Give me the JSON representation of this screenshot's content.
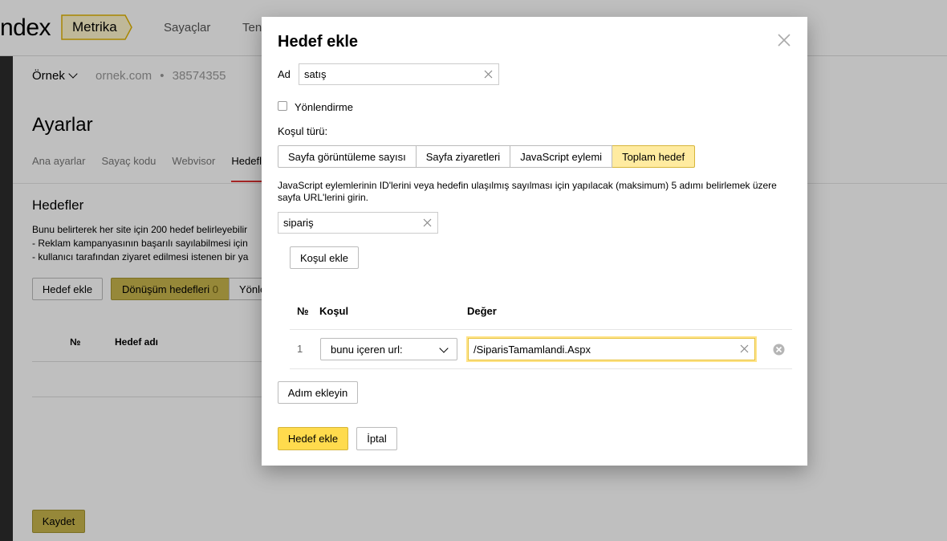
{
  "app": {
    "logo_text": "ndex",
    "product_tab": "Metrika",
    "nav": [
      "Sayaçlar",
      "Ten"
    ]
  },
  "site": {
    "name": "Örnek",
    "domain": "ornek.com",
    "separator": "•",
    "counter_id": "38574355"
  },
  "page": {
    "title": "Ayarlar",
    "tabs": [
      "Ana ayarlar",
      "Sayaç kodu",
      "Webvisor",
      "Hedefl"
    ],
    "active_tab_index": 3,
    "section_title": "Hedefler",
    "description": [
      "Bunu belirterek her site için 200 hedef belirleyebilir",
      "- Reklam kampanyasının başarılı sayılabilmesi için",
      "- kullanıcı tarafından ziyaret edilmesi istenen bir ya"
    ],
    "add_goal_button": "Hedef ekle",
    "filter_conversion": "Dönüşüm hedefleri",
    "filter_conversion_count": "0",
    "filter_other": "Yönle",
    "table_headers": [
      "№",
      "Hedef adı"
    ],
    "save_button": "Kaydet"
  },
  "modal": {
    "title": "Hedef ekle",
    "name_label": "Ad",
    "name_value": "satış",
    "redirect_label": "Yönlendirme",
    "redirect_checked": false,
    "condition_type_label": "Koşul türü:",
    "condition_types": [
      "Sayfa görüntüleme sayısı",
      "Sayfa ziyaretleri",
      "JavaScript eylemi",
      "Toplam hedef"
    ],
    "selected_condition_type_index": 3,
    "help_text": "JavaScript eylemlerinin ID'lerini veya hedefin ulaşılmış sayılması için yapılacak (maksimum) 5 adımı belirlemek üzere sayfa URL'lerini girin.",
    "step_name_value": "sipariş",
    "add_condition_button": "Koşul ekle",
    "table_headers": {
      "number": "№",
      "condition": "Koşul",
      "value": "Değer"
    },
    "rows": [
      {
        "number": "1",
        "condition": "bunu içeren url:",
        "value": "/SiparisTamamlandi.Aspx"
      }
    ],
    "add_step_button": "Adım ekleyin",
    "submit_button": "Hedef ekle",
    "cancel_button": "İptal"
  },
  "colors": {
    "accent_yellow": "#ffdb4d",
    "selected_yellow": "#ffeba0",
    "active_tab_underline": "#dd3333",
    "sidebar_dark": "#2c2c2c"
  }
}
